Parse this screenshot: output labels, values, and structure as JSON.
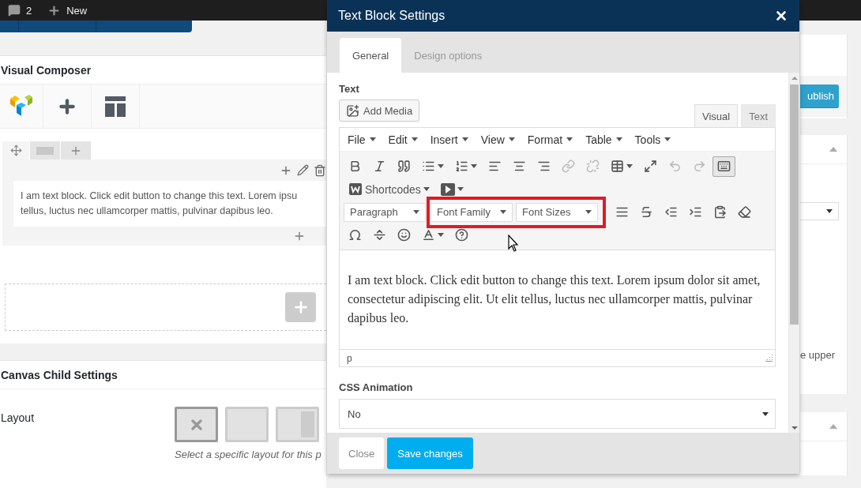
{
  "admin_bar": {
    "comments_count": "2",
    "new_label": "New"
  },
  "visual_composer": {
    "title": "Visual Composer",
    "text_lines": [
      "I am text block. Click edit button to change this text. Lorem ipsu",
      "tellus, luctus nec ullamcorper mattis, pulvinar dapibus leo."
    ]
  },
  "canvas_child": {
    "title": "Canvas Child Settings",
    "layout_label": "Layout",
    "layouts": [
      {
        "kind": "none",
        "selected": true
      },
      {
        "kind": "full",
        "selected": false
      },
      {
        "kind": "right-sidebar",
        "selected": false
      }
    ],
    "hint": "Select a specific layout for this p"
  },
  "sidebar": {
    "publish_label": "ublish",
    "note": "e upper"
  },
  "modal": {
    "title": "Text Block Settings",
    "tabs": [
      {
        "label": "General",
        "selected": true
      },
      {
        "label": "Design options",
        "selected": false
      }
    ],
    "text_label": "Text",
    "add_media": "Add Media",
    "editor_tabs": [
      {
        "label": "Visual",
        "selected": true
      },
      {
        "label": "Text",
        "selected": false
      }
    ],
    "menu": [
      "File",
      "Edit",
      "Insert",
      "View",
      "Format",
      "Table",
      "Tools"
    ],
    "toolbar_rows": [
      [
        {
          "kind": "bold",
          "disabled": false
        },
        {
          "kind": "italic",
          "disabled": false
        },
        {
          "kind": "quote",
          "disabled": false
        },
        {
          "kind": "bullet-list",
          "disabled": false
        },
        {
          "kind": "numbered-list",
          "disabled": false
        },
        {
          "kind": "align-left",
          "disabled": false
        },
        {
          "kind": "align-center",
          "disabled": false
        },
        {
          "kind": "align-right",
          "disabled": false
        },
        {
          "kind": "link",
          "disabled": true
        },
        {
          "kind": "unlink",
          "disabled": true
        },
        {
          "kind": "table",
          "disabled": false
        },
        {
          "kind": "fullscreen",
          "disabled": false
        },
        {
          "kind": "undo",
          "disabled": true
        },
        {
          "kind": "redo",
          "disabled": true
        },
        {
          "kind": "toolbar-toggle",
          "disabled": false,
          "pressed": true
        }
      ],
      [
        {
          "kind": "shortcodes",
          "label": "Shortcodes"
        },
        {
          "kind": "media"
        }
      ],
      [
        {
          "kind": "select",
          "label": "Paragraph"
        },
        {
          "kind": "highlight",
          "items": [
            {
              "kind": "select",
              "label": "Font Family"
            },
            {
              "kind": "select",
              "label": "Font Sizes"
            }
          ]
        },
        {
          "kind": "justify"
        },
        {
          "kind": "strikethrough"
        },
        {
          "kind": "outdent"
        },
        {
          "kind": "indent"
        },
        {
          "kind": "paste"
        },
        {
          "kind": "eraser"
        }
      ],
      [
        {
          "kind": "omega"
        },
        {
          "kind": "hr"
        },
        {
          "kind": "smile"
        },
        {
          "kind": "text-color"
        },
        {
          "kind": "help"
        }
      ]
    ],
    "content": "I am text block. Click edit button to change this text. Lorem ipsum dolor sit amet, consectetur adipiscing elit. Ut elit tellus, luctus nec ullamcorper mattis, pulvinar dapibus leo.",
    "status_path": "p",
    "animation_label": "CSS Animation",
    "animation_value": "No",
    "close": "Close",
    "save": "Save changes"
  }
}
